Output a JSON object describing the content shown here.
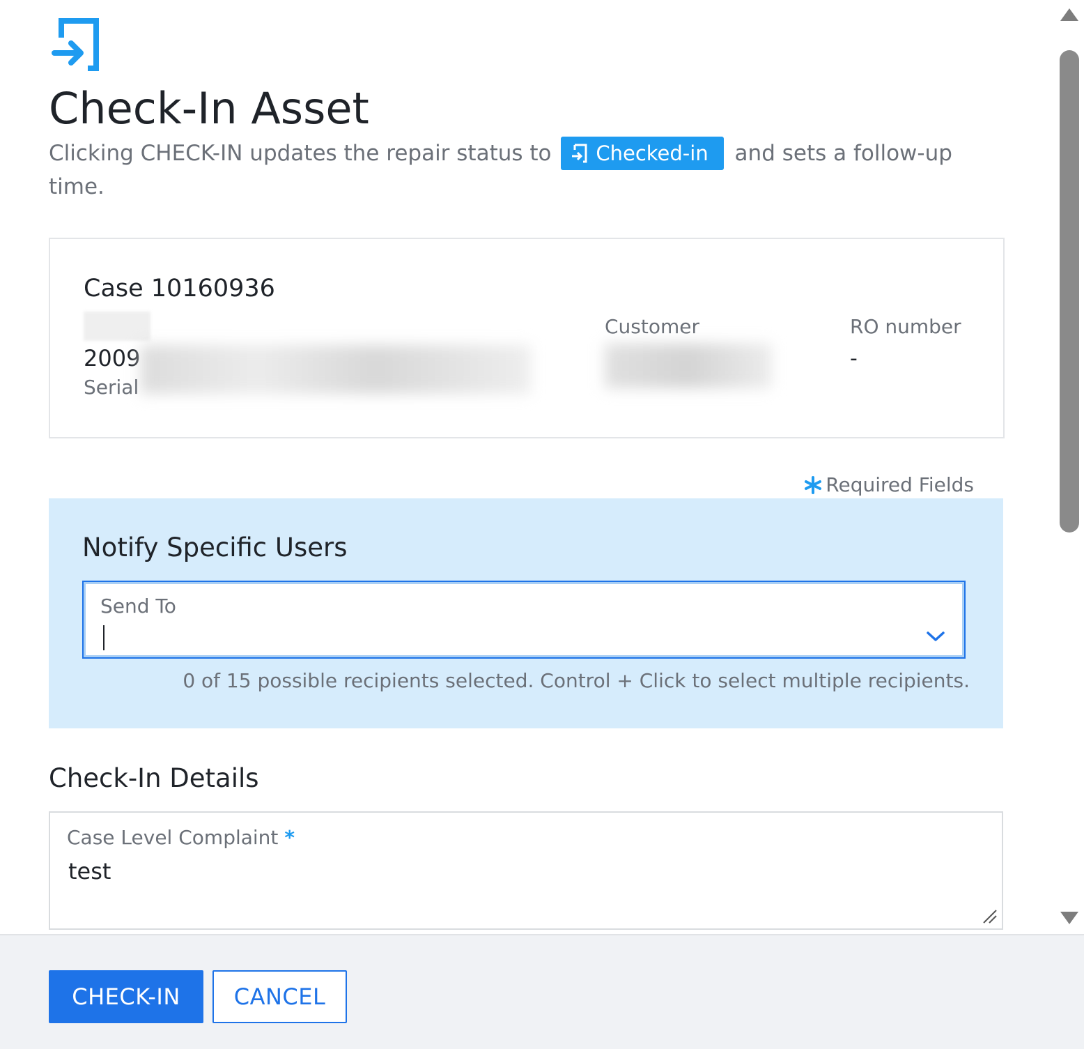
{
  "dialog": {
    "title": "Check-In Asset",
    "subtitle_before": "Clicking CHECK-IN updates the repair status to ",
    "status_chip": "Checked-in",
    "subtitle_after": " and sets a follow-up time.",
    "icon": "check-in-icon"
  },
  "case": {
    "title": "Case 10160936",
    "asset_year": "2009",
    "serial_label": "Serial",
    "customer_label": "Customer",
    "ro_label": "RO number",
    "ro_value": "-"
  },
  "form": {
    "required_note": "Required Fields",
    "notify": {
      "title": "Notify Specific Users",
      "send_to_label": "Send To",
      "help_text": "0 of 15 possible recipients selected. Control + Click to select multiple recipients."
    },
    "details": {
      "title": "Check-In Details",
      "complaint_label": "Case Level Complaint",
      "complaint_value": "test"
    }
  },
  "footer": {
    "primary": "CHECK-IN",
    "secondary": "CANCEL"
  },
  "colors": {
    "accent": "#1e73e8",
    "chip": "#1e9bf0",
    "panel": "#d6ecfc"
  }
}
